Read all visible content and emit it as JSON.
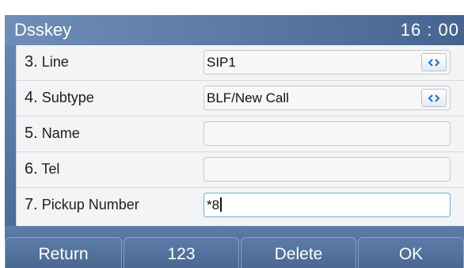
{
  "header": {
    "title": "Dsskey",
    "time": "16 : 00"
  },
  "rows": [
    {
      "num": "3.",
      "label": "Line",
      "value": "SIP1"
    },
    {
      "num": "4.",
      "label": "Subtype",
      "value": "BLF/New Call"
    },
    {
      "num": "5.",
      "label": "Name",
      "value": ""
    },
    {
      "num": "6.",
      "label": "Tel",
      "value": ""
    },
    {
      "num": "7.",
      "label": "Pickup Number",
      "value": "*8"
    }
  ],
  "softkeys": [
    "Return",
    "123",
    "Delete",
    "OK"
  ],
  "icons": {
    "selector": "left-right-arrows-icon"
  },
  "colors": {
    "header": "#5d7ca8",
    "panel": "#f3f4f6",
    "focus_border": "#6fb3c7",
    "arrow": "#1f6fd2"
  }
}
